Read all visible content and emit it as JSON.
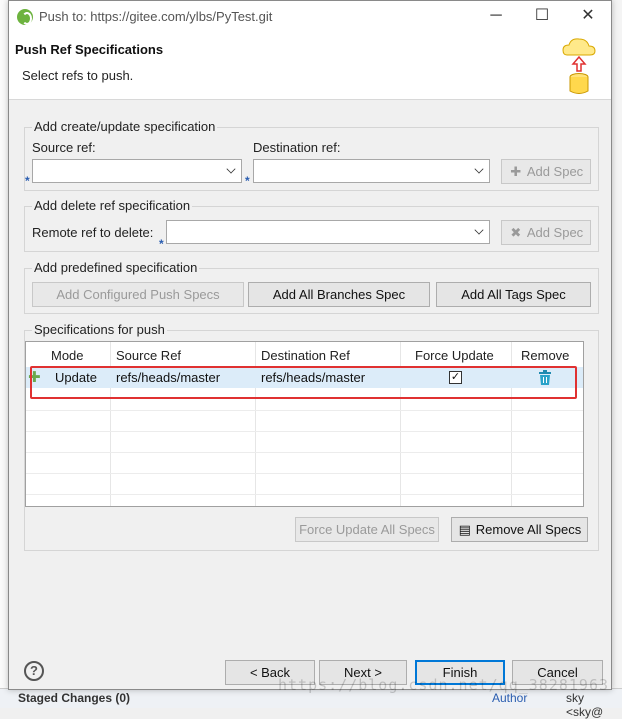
{
  "window": {
    "title": "Push to: https://gitee.com/ylbs/PyTest.git",
    "min_label": "─",
    "max_label": "☐",
    "close_label": "✕"
  },
  "banner": {
    "heading": "Push Ref Specifications",
    "subtitle": "Select refs to push."
  },
  "create_group": {
    "title": "Add create/update specification",
    "source_label": "Source ref:",
    "destination_label": "Destination ref:",
    "source_value": "",
    "destination_value": "",
    "add_spec_label": "Add Spec"
  },
  "delete_group": {
    "title": "Add delete ref specification",
    "remote_label": "Remote ref to delete:",
    "remote_value": "",
    "add_spec_label": "Add Spec"
  },
  "predefined_group": {
    "title": "Add predefined specification",
    "configured_label": "Add Configured Push Specs",
    "branches_label": "Add All Branches Spec",
    "tags_label": "Add All Tags Spec"
  },
  "specs_group": {
    "title": "Specifications for push",
    "columns": [
      "Mode",
      "Source Ref",
      "Destination Ref",
      "Force Update",
      "Remove"
    ],
    "rows": [
      {
        "mode": "Update",
        "source": "refs/heads/master",
        "destination": "refs/heads/master",
        "force_update": true
      }
    ],
    "force_all_label": "Force Update All Specs",
    "remove_all_label": "Remove All Specs"
  },
  "footer": {
    "back_label": "< Back",
    "next_label": "Next >",
    "finish_label": "Finish",
    "cancel_label": "Cancel",
    "help_label": "?"
  },
  "background": {
    "staged_label": "Staged Changes (0)",
    "right_text_1": "Author",
    "right_text_2": "sky <sky@"
  },
  "watermark": "https://blog.csdn.net/qq_38281963",
  "colors": {
    "highlight": "#e03131",
    "row_selected": "#dcecf9",
    "primary_border": "#0078d7"
  }
}
